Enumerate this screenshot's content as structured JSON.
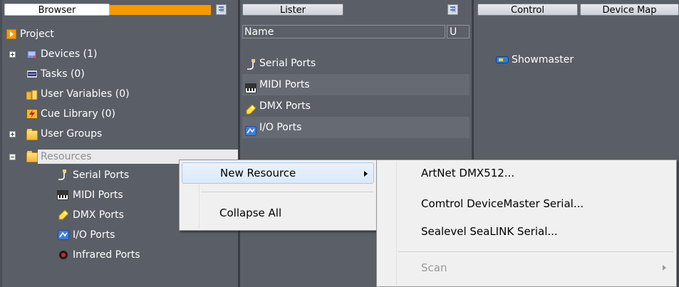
{
  "browser": {
    "tab_label": "Browser",
    "tree": [
      {
        "label": "Project"
      },
      {
        "label": "Devices (1)"
      },
      {
        "label": "Tasks (0)"
      },
      {
        "label": "User Variables (0)"
      },
      {
        "label": "Cue Library (0)"
      },
      {
        "label": "User Groups"
      },
      {
        "label": "Resources"
      },
      {
        "label": "Serial Ports"
      },
      {
        "label": "MIDI Ports"
      },
      {
        "label": "DMX Ports"
      },
      {
        "label": "I/O Ports"
      },
      {
        "label": "Infrared Ports"
      }
    ]
  },
  "lister": {
    "tab_label": "Lister",
    "columns": {
      "name": "Name",
      "u": "U"
    },
    "rows": [
      {
        "label": "Serial Ports"
      },
      {
        "label": "MIDI Ports"
      },
      {
        "label": "DMX Ports"
      },
      {
        "label": "I/O Ports"
      }
    ]
  },
  "control": {
    "tab_control": "Control",
    "tab_device_map": "Device Map",
    "device_label": "Showmaster"
  },
  "context_menu": {
    "new_resource": "New Resource",
    "collapse_all": "Collapse All"
  },
  "submenu": {
    "items": [
      {
        "label": "ArtNet DMX512..."
      },
      {
        "label": "Comtrol DeviceMaster Serial..."
      },
      {
        "label": "Sealevel SeaLINK Serial..."
      },
      {
        "label": "Scan"
      }
    ]
  },
  "colors": {
    "accent_orange": "#f59a00",
    "panel_bg": "#5a5e66",
    "menu_bg": "#f0f0f0"
  }
}
